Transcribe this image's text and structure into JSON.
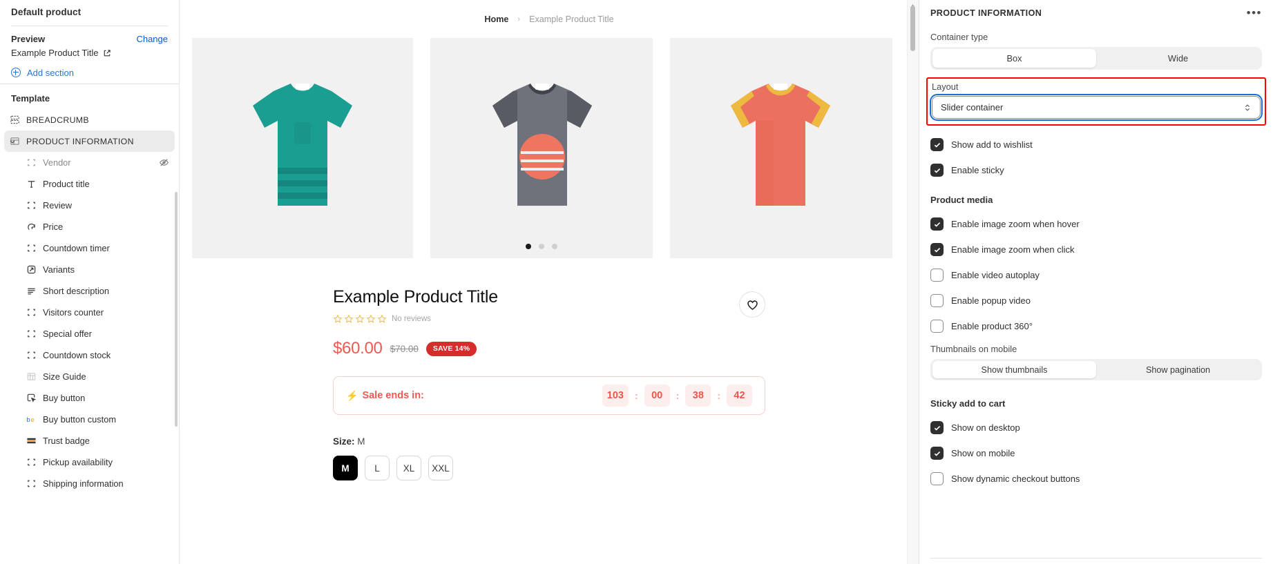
{
  "sidebar": {
    "title": "Default product",
    "preview": {
      "label": "Preview",
      "change_label": "Change",
      "value": "Example Product Title"
    },
    "add_section_label": "Add section",
    "template_label": "Template",
    "items": [
      {
        "label": "BREADCRUMB",
        "icon": "section-blocks-icon",
        "type": "section",
        "active": false
      },
      {
        "label": "PRODUCT INFORMATION",
        "icon": "product-info-icon",
        "type": "section",
        "active": true
      },
      {
        "label": "Vendor",
        "icon": "placeholder-block-icon",
        "type": "child",
        "hidden": true,
        "dim": true
      },
      {
        "label": "Product title",
        "icon": "text-icon",
        "type": "child"
      },
      {
        "label": "Review",
        "icon": "placeholder-block-icon",
        "type": "child"
      },
      {
        "label": "Price",
        "icon": "price-tag-icon",
        "type": "child"
      },
      {
        "label": "Countdown timer",
        "icon": "placeholder-block-icon",
        "type": "child"
      },
      {
        "label": "Variants",
        "icon": "variants-icon",
        "type": "child"
      },
      {
        "label": "Short description",
        "icon": "lines-icon",
        "type": "child"
      },
      {
        "label": "Visitors counter",
        "icon": "placeholder-block-icon",
        "type": "child"
      },
      {
        "label": "Special offer",
        "icon": "placeholder-block-icon",
        "type": "child"
      },
      {
        "label": "Countdown stock",
        "icon": "placeholder-block-icon",
        "type": "child"
      },
      {
        "label": "Size Guide",
        "icon": "size-guide-icon",
        "type": "child"
      },
      {
        "label": "Buy button",
        "icon": "cursor-click-icon",
        "type": "child"
      },
      {
        "label": "Buy button custom",
        "icon": "buy-custom-icon",
        "type": "child"
      },
      {
        "label": "Trust badge",
        "icon": "trust-badge-icon",
        "type": "child"
      },
      {
        "label": "Pickup availability",
        "icon": "placeholder-block-icon",
        "type": "child"
      },
      {
        "label": "Shipping information",
        "icon": "placeholder-block-icon",
        "type": "child"
      }
    ]
  },
  "preview": {
    "breadcrumb": {
      "home": "Home",
      "separator": "›",
      "current": "Example Product Title"
    },
    "gallery": {
      "dots": [
        true,
        false,
        false
      ]
    },
    "product": {
      "title": "Example Product Title",
      "stars": 5,
      "reviews_text": "No reviews",
      "price": "$60.00",
      "compare_at": "$70.00",
      "save_badge": "SAVE 14%"
    },
    "sale": {
      "label": "Sale ends in:",
      "bolt": "⚡",
      "units": [
        "103",
        "00",
        "38",
        "42"
      ],
      "separator": ":"
    },
    "size": {
      "label_prefix": "Size:",
      "selected": "M",
      "options": [
        "M",
        "L",
        "XL",
        "XXL"
      ]
    },
    "wishlist_icon": "heart-icon"
  },
  "inspector": {
    "title": "PRODUCT INFORMATION",
    "more_label": "•••",
    "container_type": {
      "label": "Container type",
      "options": [
        "Box",
        "Wide"
      ],
      "selected": "Box"
    },
    "layout": {
      "label": "Layout",
      "value": "Slider container"
    },
    "checkboxes_top": [
      {
        "label": "Show add to wishlist",
        "checked": true
      },
      {
        "label": "Enable sticky",
        "checked": true
      }
    ],
    "product_media": {
      "heading": "Product media",
      "checkboxes": [
        {
          "label": "Enable image zoom when hover",
          "checked": true
        },
        {
          "label": "Enable image zoom when click",
          "checked": true
        },
        {
          "label": "Enable video autoplay",
          "checked": false
        },
        {
          "label": "Enable popup video",
          "checked": false
        },
        {
          "label": "Enable product 360°",
          "checked": false
        }
      ],
      "thumbnails": {
        "label": "Thumbnails on mobile",
        "options": [
          "Show thumbnails",
          "Show pagination"
        ],
        "selected": "Show thumbnails"
      }
    },
    "sticky_cart": {
      "heading": "Sticky add to cart",
      "checkboxes": [
        {
          "label": "Show on desktop",
          "checked": true
        },
        {
          "label": "Show on mobile",
          "checked": true
        },
        {
          "label": "Show dynamic checkout buttons",
          "checked": false
        }
      ]
    }
  },
  "colors": {
    "accent_link": "#005bd3",
    "price": "#ee5a52",
    "badge": "#d72c2c",
    "highlight": "#ff0000",
    "focus_ring": "#1a6ed8"
  }
}
